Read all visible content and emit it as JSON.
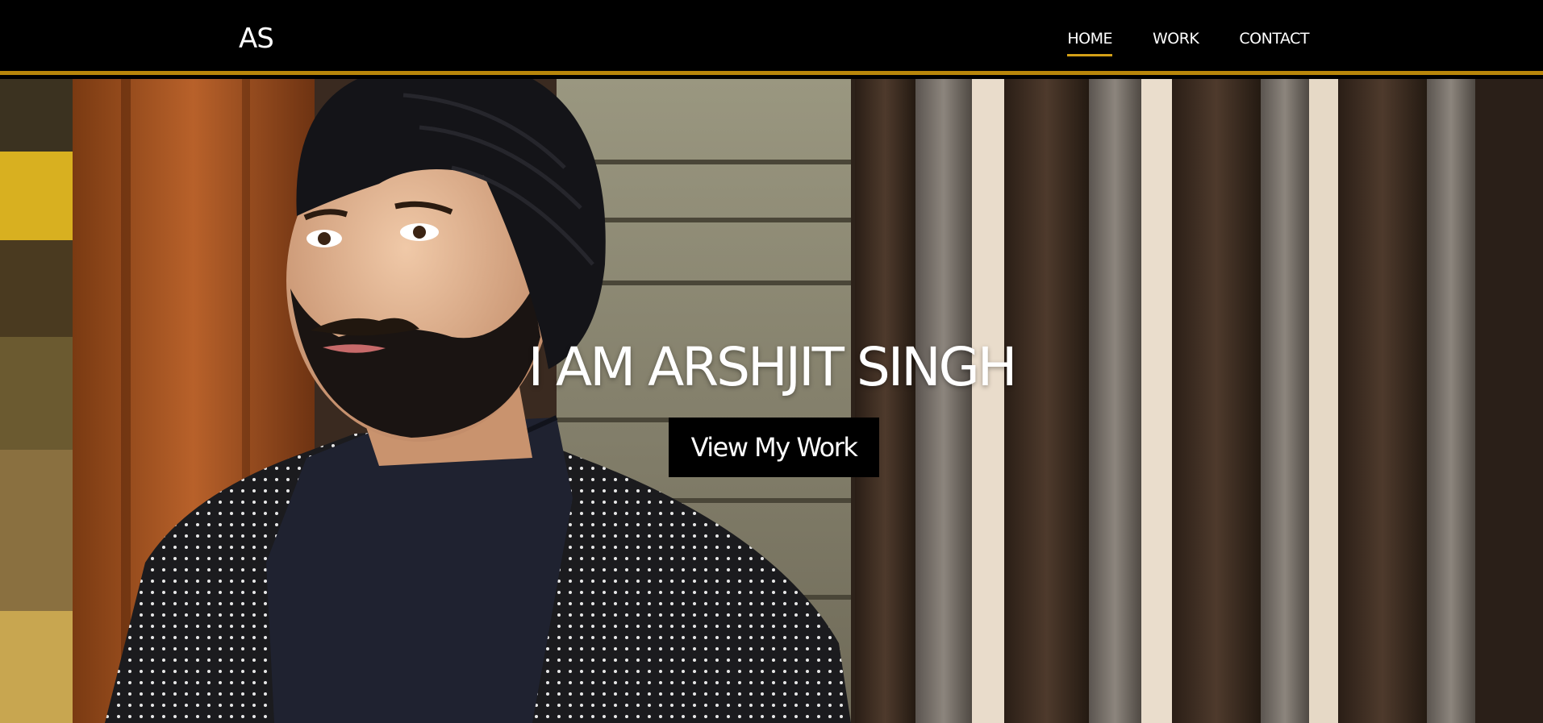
{
  "brand": "AS",
  "nav": {
    "items": [
      {
        "label": "HOME",
        "active": true
      },
      {
        "label": "WORK",
        "active": false
      },
      {
        "label": "CONTACT",
        "active": false
      }
    ]
  },
  "hero": {
    "title": "I AM ARSHJIT SINGH",
    "cta_label": "View My Work"
  },
  "colors": {
    "accent": "#b8860b",
    "nav_background": "#000000",
    "button_background": "#000000",
    "text": "#ffffff"
  }
}
